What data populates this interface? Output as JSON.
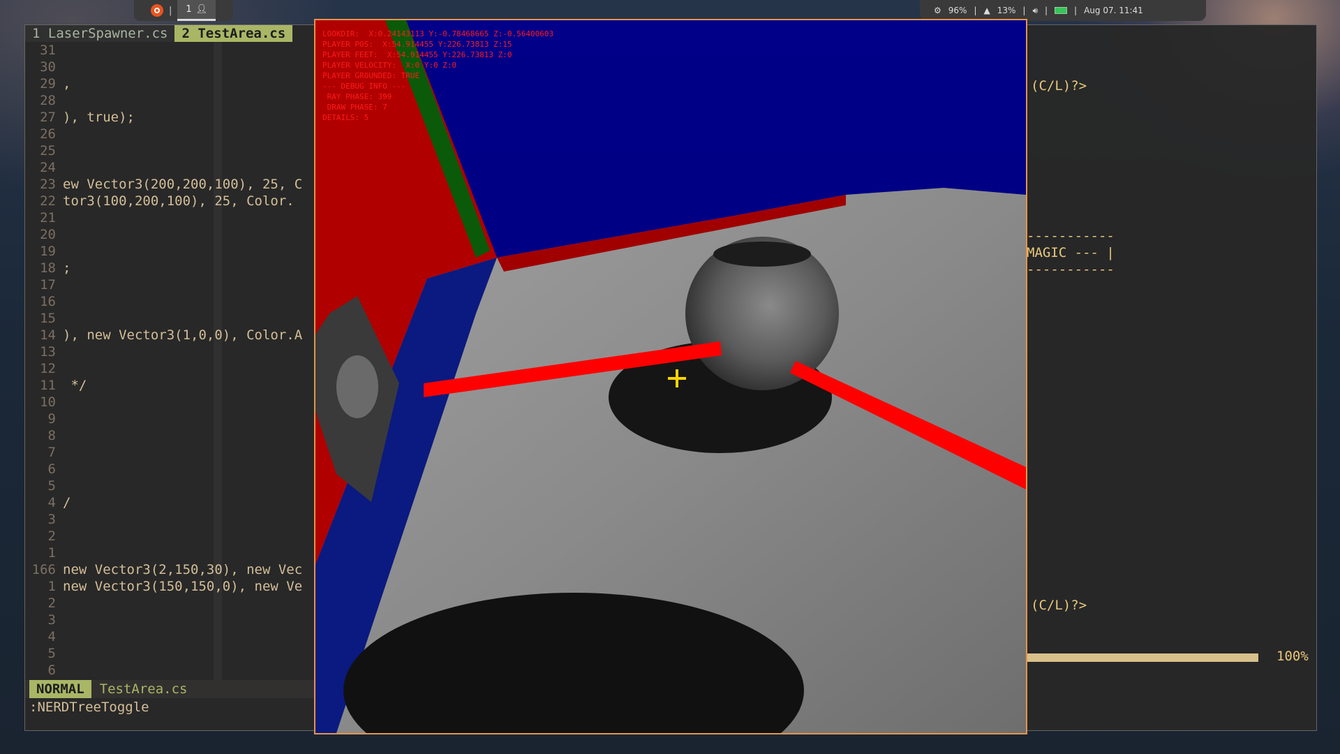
{
  "topbar": {
    "workspace_label": "1",
    "cpu": "96%",
    "disk": "13%",
    "datetime": "Aug 07. 11:41",
    "separator": "|"
  },
  "editor": {
    "tabs": [
      {
        "label": "1 LaserSpawner.cs"
      },
      {
        "label": "2 TestArea.cs"
      }
    ],
    "lines": [
      {
        "num": "31",
        "code": ""
      },
      {
        "num": "30",
        "code": ""
      },
      {
        "num": "29",
        "code": ","
      },
      {
        "num": "28",
        "code": ""
      },
      {
        "num": "27",
        "code": "), true);"
      },
      {
        "num": "26",
        "code": ""
      },
      {
        "num": "25",
        "code": ""
      },
      {
        "num": "24",
        "code": ""
      },
      {
        "num": "23",
        "code": "ew Vector3(200,200,100), 25, C"
      },
      {
        "num": "22",
        "code": "tor3(100,200,100), 25, Color."
      },
      {
        "num": "21",
        "code": ""
      },
      {
        "num": "20",
        "code": ""
      },
      {
        "num": "19",
        "code": ""
      },
      {
        "num": "18",
        "code": ";"
      },
      {
        "num": "17",
        "code": ""
      },
      {
        "num": "16",
        "code": ""
      },
      {
        "num": "15",
        "code": ""
      },
      {
        "num": "14",
        "code": "), new Vector3(1,0,0), Color.A"
      },
      {
        "num": "13",
        "code": ""
      },
      {
        "num": "12",
        "code": ""
      },
      {
        "num": "11",
        "code": " */"
      },
      {
        "num": "10",
        "code": ""
      },
      {
        "num": "9",
        "code": ""
      },
      {
        "num": "8",
        "code": ""
      },
      {
        "num": "7",
        "code": ""
      },
      {
        "num": "6",
        "code": ""
      },
      {
        "num": "5",
        "code": ""
      },
      {
        "num": "4",
        "code": "/"
      },
      {
        "num": "3",
        "code": ""
      },
      {
        "num": "2",
        "code": ""
      },
      {
        "num": "1",
        "code": ""
      },
      {
        "num": "166",
        "code": "new Vector3(2,150,30), new Vec"
      },
      {
        "num": "1",
        "code": "new Vector3(150,150,0), new Ve"
      },
      {
        "num": "2",
        "code": ""
      },
      {
        "num": "3",
        "code": ""
      },
      {
        "num": "4",
        "code": ""
      },
      {
        "num": "5",
        "code": ""
      },
      {
        "num": "6",
        "code": ""
      }
    ],
    "mode": "NORMAL",
    "filename": "TestArea.cs",
    "cmdline": ":NERDTreeToggle"
  },
  "terminal": {
    "prompt1": "(C/L)?>",
    "rule1": "-----------",
    "banner": "MAGIC --- |",
    "rule2": "-----------",
    "prompt2": "(C/L)?>",
    "progress_pct": "100%",
    "progress_value": 1.0
  },
  "game": {
    "debug_lines": [
      "LOOKDIR:  X:0.24143113 Y:-0.78468665 Z:-0.56400603",
      "PLAYER POS:  X:54.914455 Y:226.73813 Z:15",
      "PLAYER FEET:  X:54.914455 Y:226.73813 Z:0",
      "PLAYER VELOCITY:  X:0 Y:0 Z:0",
      "PLAYER GROUNDED: TRUE",
      "--- DEBUG INFO ---",
      " RAY PHASE: 399",
      " DRAW PHASE: 7",
      "DETAILS: 5"
    ],
    "crosshair_color": "#ffd400",
    "laser_color": "#ff0000"
  }
}
